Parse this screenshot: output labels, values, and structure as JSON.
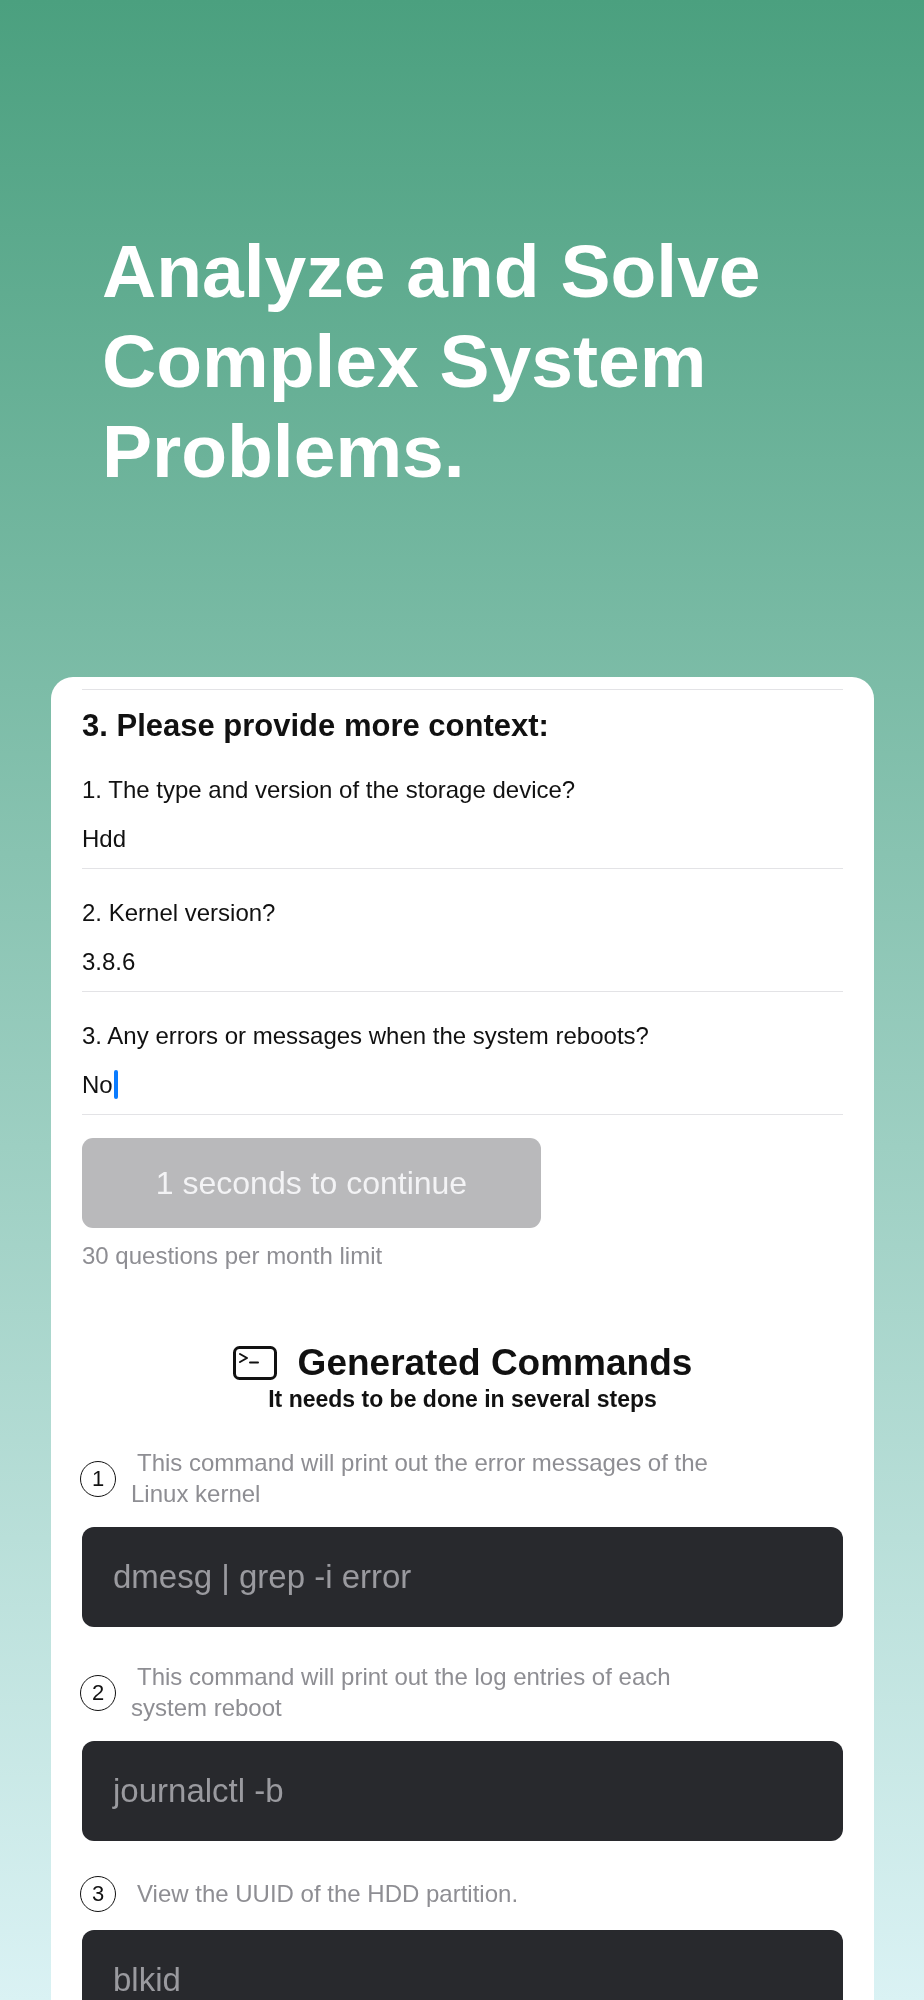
{
  "hero": {
    "title": "Analyze and Solve Complex System Problems."
  },
  "context_form": {
    "heading": "3. Please provide more context:",
    "questions": [
      {
        "label": "1. The type and version of the storage device?",
        "value": "Hdd",
        "focused": false
      },
      {
        "label": "2. Kernel version?",
        "value": "3.8.6",
        "focused": false
      },
      {
        "label": "3. Any errors or messages when the system reboots?",
        "value": "No",
        "focused": true
      }
    ],
    "continue_button": {
      "label": "1 seconds to continue",
      "disabled": true
    },
    "limit_note": "30 questions per month limit"
  },
  "commands": {
    "title": "Generated Commands",
    "subtitle": "It needs to be done in several steps",
    "steps": [
      {
        "number": "1",
        "description": "This command will print out the error messages of the Linux kernel",
        "command": "dmesg | grep -i error"
      },
      {
        "number": "2",
        "description": "This command will print out the log entries of each system reboot",
        "command": "journalctl -b"
      },
      {
        "number": "3",
        "description": "View the UUID of the HDD partition.",
        "command": "blkid"
      }
    ]
  }
}
